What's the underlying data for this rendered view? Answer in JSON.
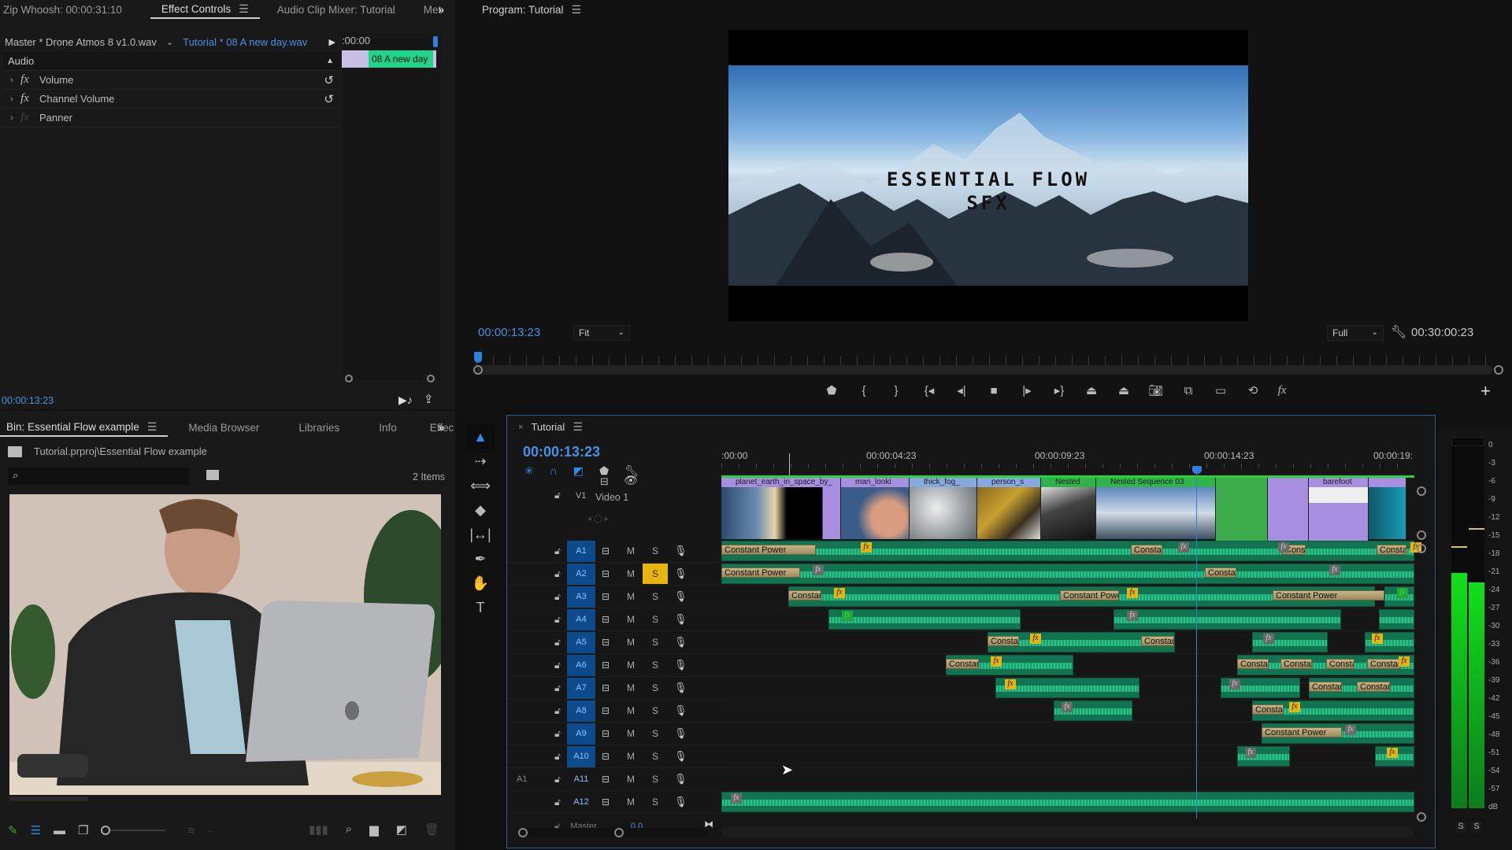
{
  "effect_controls": {
    "tabs": [
      {
        "label": "Zip Whoosh: 00:00:31:10",
        "active": false
      },
      {
        "label": "Effect Controls",
        "active": true
      },
      {
        "label": "Audio Clip Mixer: Tutorial",
        "active": false
      },
      {
        "label": "Met",
        "active": false
      }
    ],
    "overflow_label": "»",
    "master_source": "Master * Drone Atmos 8 v1.0.wav",
    "sequence_source": "Tutorial * 08 A new day.wav",
    "section_label": "Audio",
    "effects": [
      {
        "name": "Volume",
        "fx_enabled": true,
        "has_reset": true
      },
      {
        "name": "Channel Volume",
        "fx_enabled": true,
        "has_reset": true
      },
      {
        "name": "Panner",
        "fx_enabled": false,
        "has_reset": false
      }
    ],
    "mini_timeline": {
      "start_label": ":00:00",
      "clip_label": "08 A new day"
    },
    "timecode": "00:00:13:23"
  },
  "program_monitor": {
    "title": "Program: Tutorial",
    "overlay_title_line1": "ESSENTIAL FLOW",
    "overlay_title_line2": "SFX",
    "timecode": "00:00:13:23",
    "zoom_select": "Fit",
    "quality_select": "Full",
    "duration": "00:30:00:23",
    "playhead_fraction": 0.0,
    "transport_buttons": [
      "add-marker",
      "mark-in",
      "mark-out",
      "go-to-in",
      "step-back",
      "stop",
      "step-forward",
      "go-to-out",
      "lift",
      "extract",
      "export-frame",
      "insert",
      "overwrite",
      "comparison-view",
      "fx"
    ]
  },
  "bin": {
    "tabs": [
      {
        "label": "Bin: Essential Flow example",
        "active": true
      },
      {
        "label": "Media Browser",
        "active": false
      },
      {
        "label": "Libraries",
        "active": false
      },
      {
        "label": "Info",
        "active": false
      },
      {
        "label": "Effec",
        "active": false
      }
    ],
    "overflow_label": "»",
    "path": "Tutorial.prproj\\Essential Flow example",
    "search_placeholder": "",
    "item_count": "2 Items"
  },
  "timeline": {
    "title": "Tutorial",
    "timecode": "00:00:13:23",
    "ruler_labels": [
      ":00:00",
      "00:00:04:23",
      "00:00:09:23",
      "00:00:14:23",
      "00:00:19:"
    ],
    "video_track": {
      "id": "V1",
      "name": "Video 1"
    },
    "video_clips": [
      {
        "label": "planet_earth_in_space_by_"
      },
      {
        "label": "man_looki"
      },
      {
        "label": "thick_fog_"
      },
      {
        "label": "person_s"
      },
      {
        "label": "Nested"
      },
      {
        "label": "Nested Sequence 03"
      },
      {
        "label": ""
      },
      {
        "label": "barefoot"
      },
      {
        "label": ""
      }
    ],
    "audio_tracks": [
      {
        "id": "A1",
        "source": "",
        "targeted": true,
        "solo": false
      },
      {
        "id": "A2",
        "source": "",
        "targeted": true,
        "solo": true
      },
      {
        "id": "A3",
        "source": "",
        "targeted": true,
        "solo": false
      },
      {
        "id": "A4",
        "source": "",
        "targeted": true,
        "solo": false
      },
      {
        "id": "A5",
        "source": "",
        "targeted": true,
        "solo": false
      },
      {
        "id": "A6",
        "source": "",
        "targeted": true,
        "solo": false
      },
      {
        "id": "A7",
        "source": "",
        "targeted": true,
        "solo": false
      },
      {
        "id": "A8",
        "source": "",
        "targeted": true,
        "solo": false
      },
      {
        "id": "A9",
        "source": "",
        "targeted": true,
        "solo": false
      },
      {
        "id": "A10",
        "source": "",
        "targeted": true,
        "solo": false
      },
      {
        "id": "A11",
        "source": "A1",
        "targeted": false,
        "solo": false
      },
      {
        "id": "A12",
        "source": "",
        "targeted": false,
        "solo": false
      }
    ],
    "mute_label": "M",
    "solo_label": "S",
    "master_label": "Master",
    "master_value": "0.0",
    "transition_label_full": "Constant Power",
    "transition_label_short": "Constan"
  },
  "audio_meter": {
    "scale": [
      "0",
      "-3",
      "-6",
      "-9",
      "-12",
      "-15",
      "-18",
      "-21",
      "-24",
      "-27",
      "-30",
      "-33",
      "-36",
      "-39",
      "-42",
      "-45",
      "-48",
      "-51",
      "-54",
      "-57",
      "dB"
    ],
    "left_level_db": -21,
    "right_level_db": -22.5,
    "left_peak_db": -16.5,
    "right_peak_db": -13.5,
    "solo_labels": [
      "S",
      "S"
    ]
  }
}
